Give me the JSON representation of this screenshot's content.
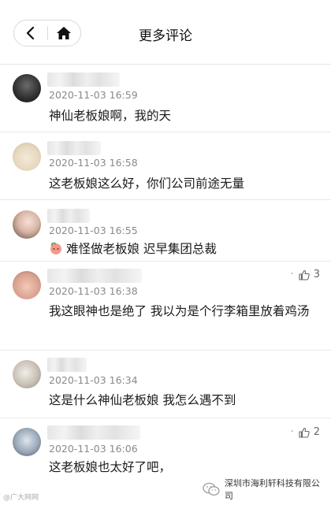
{
  "header": {
    "title": "更多评论",
    "back_icon": "chevron-left-icon",
    "home_icon": "home-icon"
  },
  "comments": [
    {
      "time": "2020-11-03 16:59",
      "text": "神仙老板娘啊，我的天",
      "likes": ""
    },
    {
      "time": "2020-11-03 16:58",
      "text": "这老板娘这么好，你们公司前途无量",
      "likes": ""
    },
    {
      "time": "2020-11-03 16:55",
      "text": "难怪做老板娘 迟早集团总裁",
      "likes": ""
    },
    {
      "time": "2020-11-03 16:38",
      "text": "我这眼神也是绝了 我以为是个行李箱里放着鸡汤",
      "likes": "3"
    },
    {
      "time": "2020-11-03 16:34",
      "text": "这是什么神仙老板娘 我怎么遇不到",
      "likes": ""
    },
    {
      "time": "2020-11-03 16:06",
      "text": "这老板娘也太好了吧，",
      "likes": "2"
    }
  ],
  "watermark": {
    "right": "深圳市海利轩科技有限公司",
    "left": "@广大网网"
  },
  "colors": {
    "divider": "#e9e9e9",
    "time": "#8a8a8a",
    "text": "#1a1a1a"
  }
}
